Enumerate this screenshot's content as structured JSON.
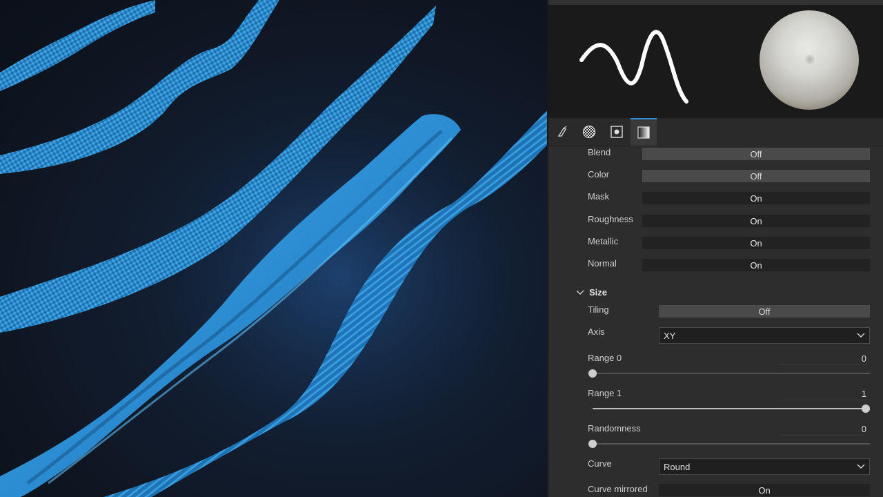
{
  "tabs": [
    {
      "icon": "brush-stroke-icon",
      "active": false
    },
    {
      "icon": "checker-sphere-icon",
      "active": false
    },
    {
      "icon": "dot-square-icon",
      "active": false
    },
    {
      "icon": "gradient-square-icon",
      "active": true
    }
  ],
  "channels": [
    {
      "label": "Blend",
      "value": "Off",
      "state": "off"
    },
    {
      "label": "Color",
      "value": "Off",
      "state": "off"
    },
    {
      "label": "Mask",
      "value": "On",
      "state": "on"
    },
    {
      "label": "Roughness",
      "value": "On",
      "state": "on"
    },
    {
      "label": "Metallic",
      "value": "On",
      "state": "on"
    },
    {
      "label": "Normal",
      "value": "On",
      "state": "on"
    }
  ],
  "size": {
    "header": "Size",
    "tiling": {
      "label": "Tiling",
      "value": "Off"
    },
    "axis": {
      "label": "Axis",
      "value": "XY"
    },
    "range0": {
      "label": "Range 0",
      "value": "0",
      "fraction": 0
    },
    "range1": {
      "label": "Range 1",
      "value": "1",
      "fraction": 1
    },
    "randomness": {
      "label": "Randomness",
      "value": "0",
      "fraction": 0
    },
    "curve": {
      "label": "Curve",
      "value": "Round"
    },
    "curve_mirrored": {
      "label": "Curve mirrored",
      "value": "On"
    }
  },
  "colors": {
    "stroke": "#2e92d6",
    "accent": "#2f8fd8",
    "panel": "#2d2d2d"
  }
}
